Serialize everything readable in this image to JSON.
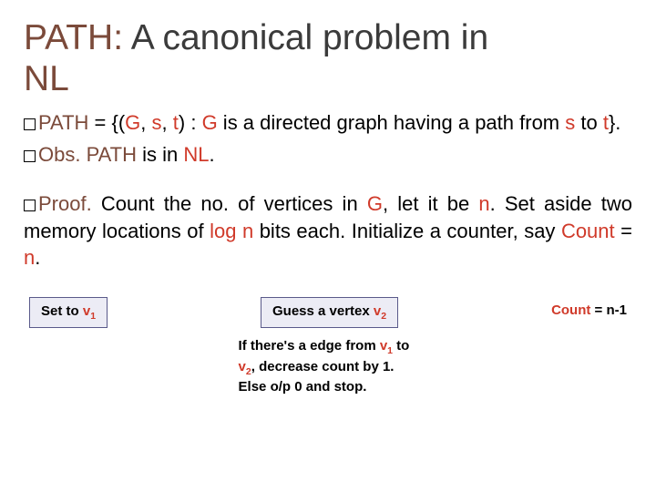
{
  "title": {
    "path": "PATH:",
    "mid": "  A canonical problem in ",
    "nl": "NL"
  },
  "p1": {
    "path_word": "PATH",
    "rest1": " = {(",
    "g": "G",
    "sep1": ", ",
    "s": "s",
    "sep2": ", ",
    "t": "t",
    "rest2": ") : ",
    "g2": "G",
    "rest3": " is a directed graph having a path from ",
    "s2": "s",
    "rest4": " to ",
    "t2": "t",
    "rest5": "}."
  },
  "p2": {
    "obs": "Obs.",
    "rest1": "  ",
    "path": "PATH",
    "rest2": " is in ",
    "nl": "NL",
    "rest3": "."
  },
  "p3": {
    "proof": "Proof.",
    "rest1": " Count the no. of vertices in ",
    "g": "G",
    "rest2": ", let it be ",
    "n": "n",
    "rest3": ". Set aside two memory locations of ",
    "logn": "log n",
    "rest4": " bits each. Initialize a counter, say ",
    "count": "Count",
    "rest5": " = ",
    "n2": "n",
    "rest6": "."
  },
  "flow": {
    "box1_pre": "Set to ",
    "box1_v": "v",
    "box1_sub": "1",
    "box2_pre": "Guess a vertex ",
    "box2_v": "v",
    "box2_sub": "2",
    "caption_pre": "If there's a edge from ",
    "caption_v1": "v",
    "caption_s1": "1",
    "caption_mid": " to ",
    "caption_v2": "v",
    "caption_s2": "2",
    "caption_post": ", decrease count by 1. Else o/p 0 and stop.",
    "label_pre": "Count",
    "label_post": " = n-1"
  }
}
